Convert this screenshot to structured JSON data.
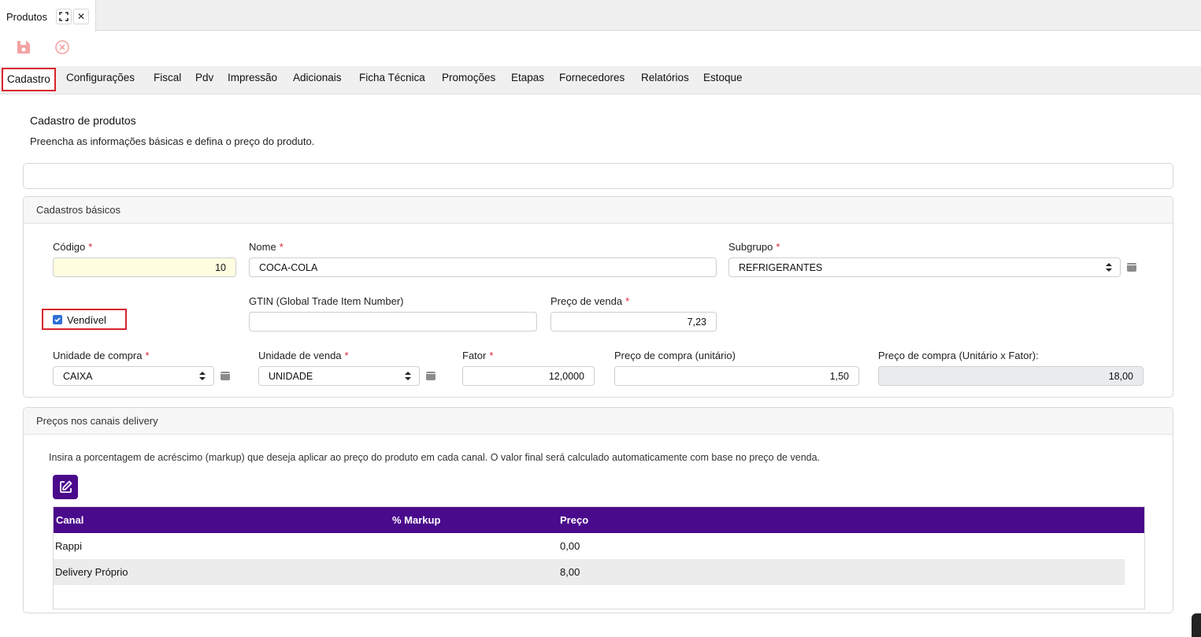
{
  "window_tab": {
    "title": "Produtos",
    "expand_icon": "expand-icon",
    "close_icon": "close-icon",
    "close_glyph": "✕"
  },
  "toolbar": {
    "save_icon": "save-icon",
    "cancel_icon": "cancel-icon"
  },
  "subtabs": [
    "Cadastro",
    "Configurações",
    "Fiscal",
    "Pdv",
    "Impressão",
    "Adicionais",
    "Ficha Técnica",
    "Promoções",
    "Etapas",
    "Fornecedores",
    "Relatórios",
    "Estoque"
  ],
  "active_subtab": "Cadastro",
  "page": {
    "title": "Cadastro de produtos",
    "subtitle": "Preencha as informações básicas e defina o preço do produto."
  },
  "basic": {
    "panel_title": "Cadastros básicos",
    "codigo_label": "Código",
    "codigo_value": "10",
    "nome_label": "Nome",
    "nome_value": "COCA-COLA",
    "subgrupo_label": "Subgrupo",
    "subgrupo_value": "REFRIGERANTES",
    "vendivel_label": "Vendível",
    "vendivel_checked": true,
    "gtin_label": "GTIN (Global Trade Item Number)",
    "gtin_value": "",
    "preco_venda_label": "Preço de venda",
    "preco_venda_value": "7,23",
    "unidade_compra_label": "Unidade de compra",
    "unidade_compra_value": "CAIXA",
    "unidade_venda_label": "Unidade de venda",
    "unidade_venda_value": "UNIDADE",
    "fator_label": "Fator",
    "fator_value": "12,0000",
    "preco_compra_label": "Preço de compra (unitário)",
    "preco_compra_value": "1,50",
    "preco_compra_total_label": "Preço de compra (Unitário x Fator):",
    "preco_compra_total_value": "18,00",
    "required_mark": "*"
  },
  "delivery": {
    "panel_title": "Preços nos canais delivery",
    "hint": "Insira a porcentagem de acréscimo (markup) que deseja aplicar ao preço do produto em cada canal. O valor final será calculado automaticamente com base no preço de venda.",
    "edit_icon": "edit-icon",
    "columns": [
      "Canal",
      "% Markup",
      "Preço"
    ],
    "rows": [
      {
        "canal": "Rappi",
        "markup": "",
        "preco": "0,00"
      },
      {
        "canal": "Delivery Próprio",
        "markup": "",
        "preco": "8,00"
      }
    ]
  },
  "colors": {
    "accent": "#4a0a8c",
    "highlight": "#d9232e",
    "checkbox": "#2f6fd6"
  }
}
